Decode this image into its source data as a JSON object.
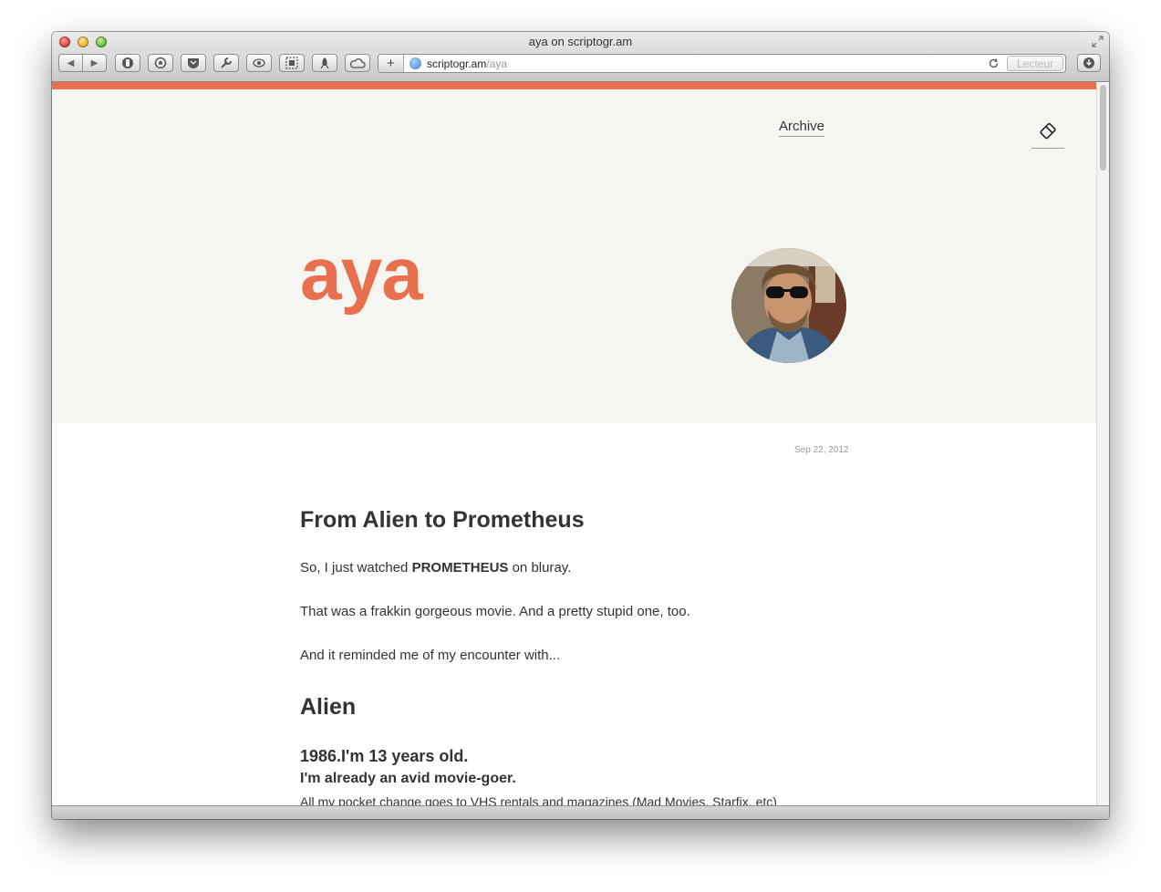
{
  "window": {
    "title": "aya on scriptogr.am"
  },
  "toolbar": {
    "back_icon": "◀",
    "forward_icon": "▶",
    "icons": [
      "privacy-icon",
      "settings-icon",
      "pocket-icon",
      "wrench-icon",
      "eye-icon",
      "screenshot-icon",
      "rocket-icon",
      "cloud-icon"
    ],
    "new_tab_icon": "+",
    "download_icon": "download-icon"
  },
  "address": {
    "host": "scriptogr.am",
    "path": "/aya",
    "reader_label": "Lecteur"
  },
  "colors": {
    "accent": "#e8704f",
    "hero_bg": "#f5f5f2"
  },
  "site": {
    "archive_label": "Archive",
    "blog_name": "aya"
  },
  "post": {
    "date": "Sep 22, 2012",
    "title": "From Alien to Prometheus",
    "p1_before": "So, I just watched ",
    "p1_bold": "PROMETHEUS",
    "p1_after": " on bluray.",
    "p2": "That was a frakkin gorgeous movie. And a pretty stupid one, too.",
    "p3": "And it reminded me of my encounter with...",
    "h2": "Alien",
    "h3": "1986.I'm 13 years old.",
    "sub": "I'm already an avid movie-goer.",
    "cut_line": "All my pocket change goes to VHS rentals and magazines (Mad Movies, Starfix, etc)"
  }
}
